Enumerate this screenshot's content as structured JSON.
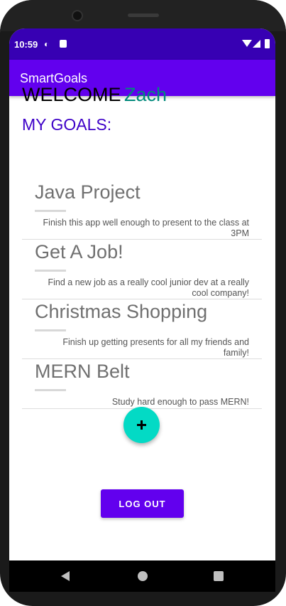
{
  "status_bar": {
    "time": "10:59",
    "icons": [
      "data-saver-icon",
      "sd-card-icon",
      "wifi-icon",
      "signal-icon",
      "battery-icon"
    ]
  },
  "app_bar": {
    "title": "SmartGoals"
  },
  "welcome": {
    "label": "WELCOME",
    "name": "Zach"
  },
  "goals_heading": "MY GOALS:",
  "goals": [
    {
      "title": "Java Project",
      "description": "Finish this app well enough to present to the class at 3PM"
    },
    {
      "title": "Get A Job!",
      "description": "Find a new job as a really cool junior dev at a really cool company!"
    },
    {
      "title": "Christmas Shopping",
      "description": "Finish up getting presents for all my friends and family!"
    },
    {
      "title": "MERN Belt",
      "description": "Study hard enough to pass MERN!"
    }
  ],
  "fab": {
    "icon": "plus-icon"
  },
  "logout_button": "LOG OUT",
  "navigation": {
    "icons": [
      "back-icon",
      "home-icon",
      "recents-icon"
    ]
  },
  "colors": {
    "status_bar": "#3700b3",
    "app_bar": "#6200ee",
    "accent": "#03dac5",
    "name": "#00897b",
    "heading": "#3d00c8"
  }
}
